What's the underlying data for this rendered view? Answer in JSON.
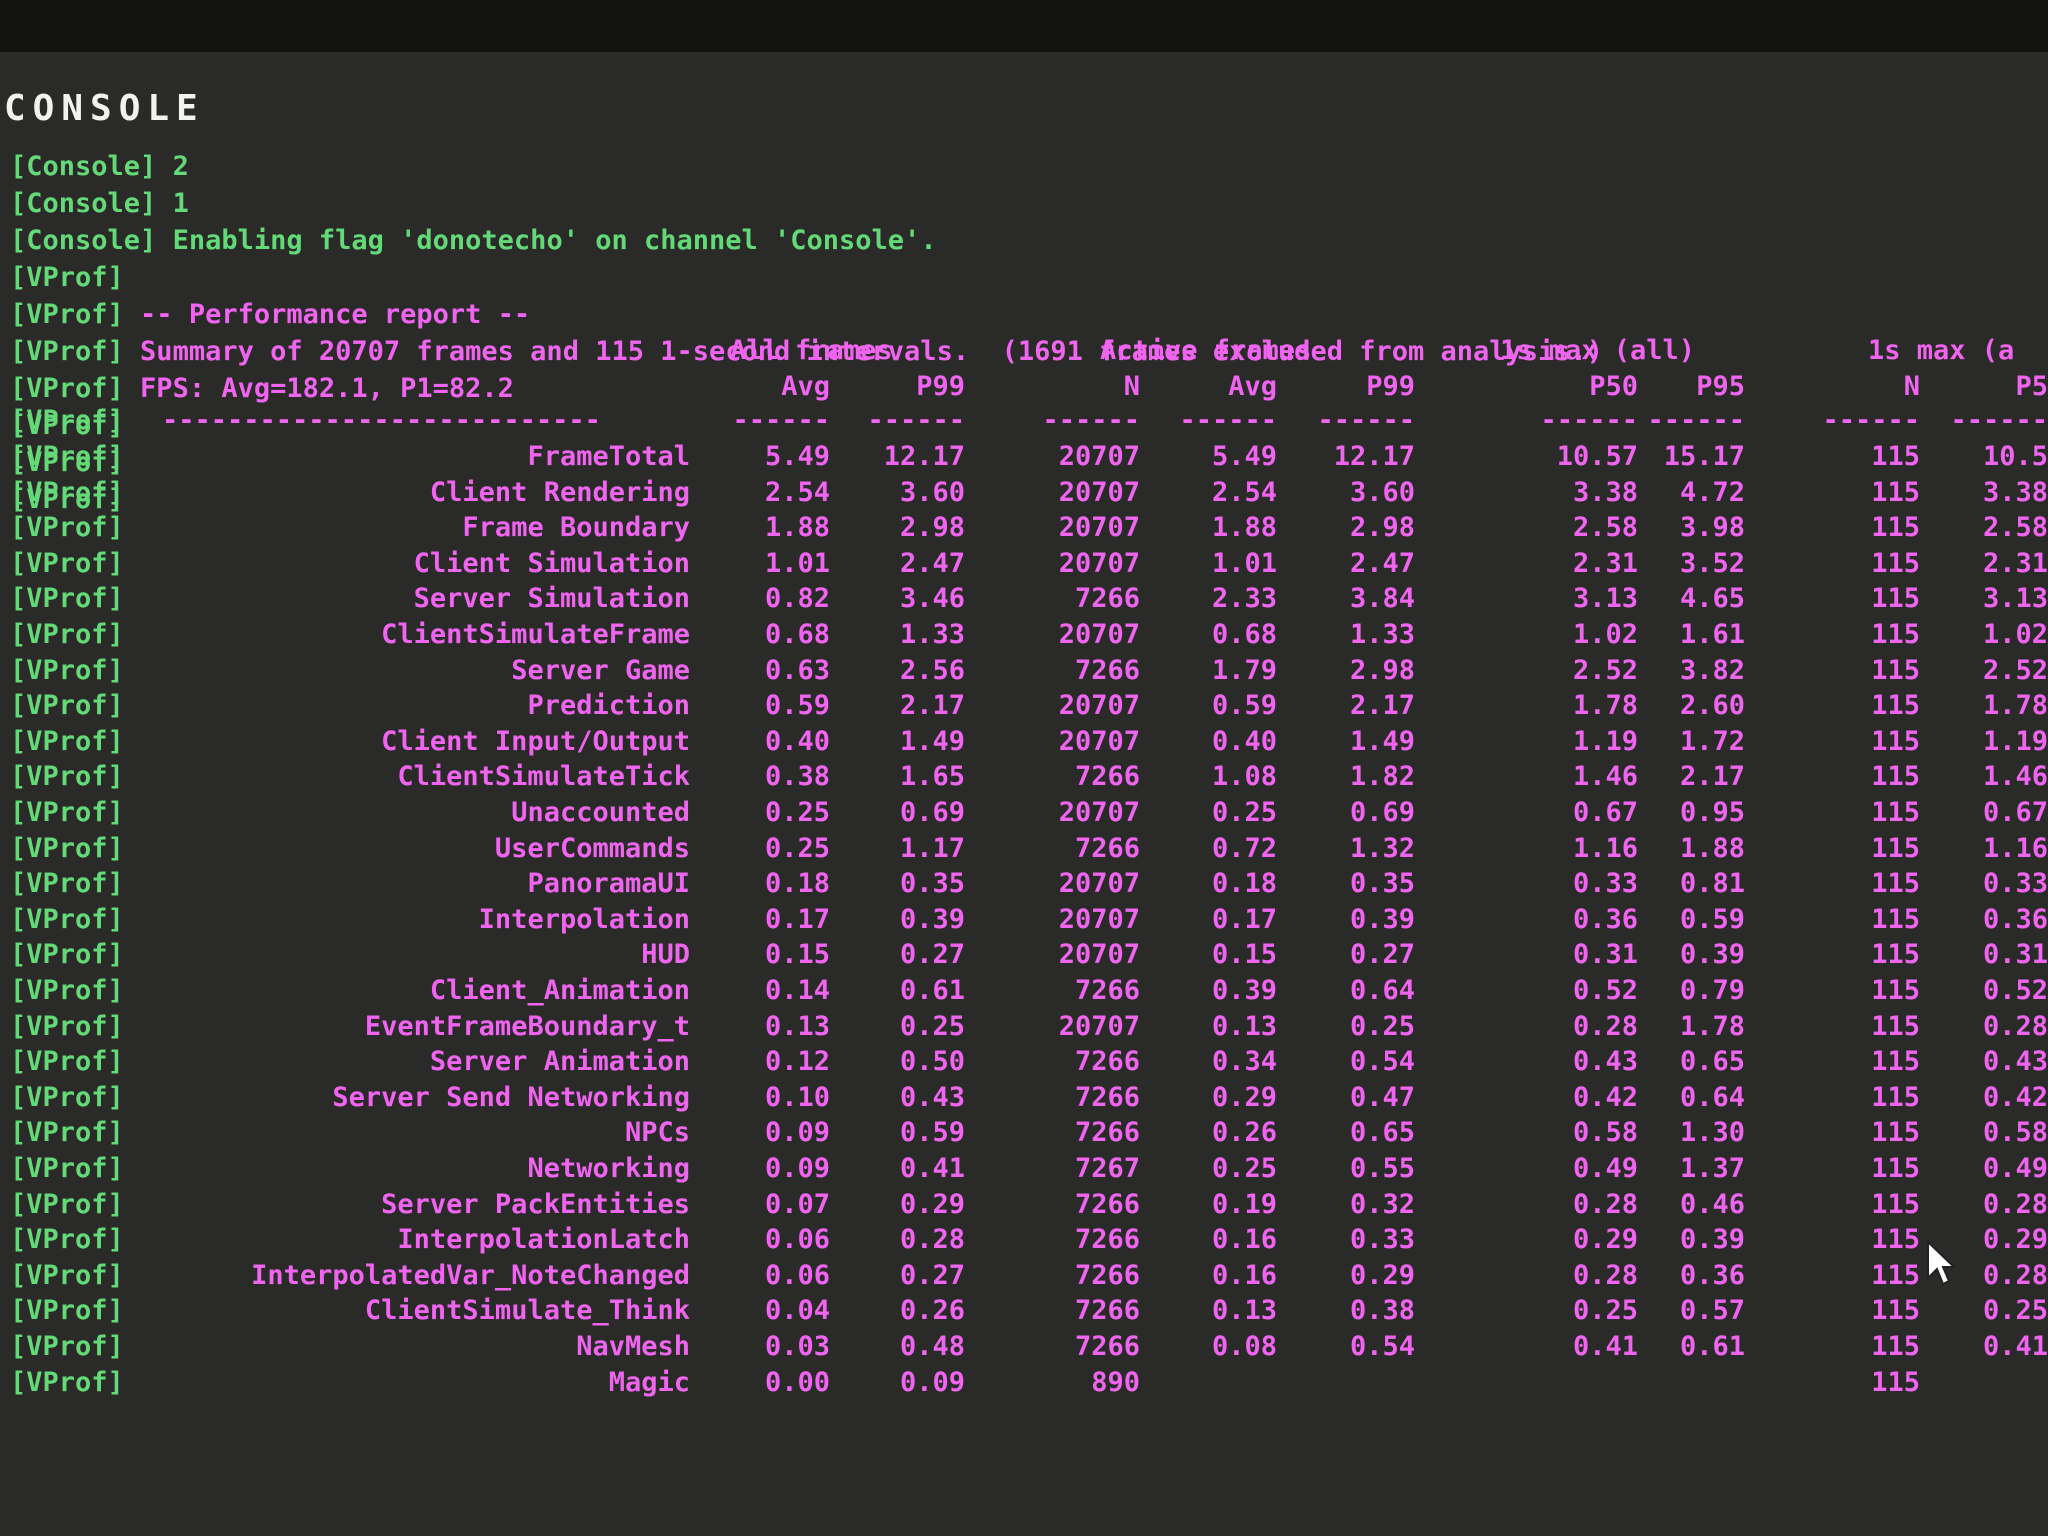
{
  "console": {
    "title": "CONSOLE",
    "lines": [
      {
        "tag": "[Console]",
        "text": " 2",
        "color": "green"
      },
      {
        "tag": "[Console]",
        "text": " 1",
        "color": "green"
      },
      {
        "tag": "[Console]",
        "text": " Enabling flag 'donotecho' on channel 'Console'.",
        "color": "green"
      },
      {
        "tag": "[VProf]",
        "text": "",
        "color": "pink"
      },
      {
        "tag": "[VProf]",
        "text": " -- Performance report --",
        "color": "pink"
      },
      {
        "tag": "[VProf]",
        "text": " Summary of 20707 frames and 115 1-second intervals.  (1691 frames excluded from analysis.)",
        "color": "pink"
      },
      {
        "tag": "[VProf]",
        "text": " FPS: Avg=182.1, P1=82.2",
        "color": "pink"
      },
      {
        "tag": "[VProf]",
        "text": "",
        "color": "pink"
      },
      {
        "tag": "[VProf]",
        "text": "",
        "color": "pink"
      },
      {
        "tag": "[VProf]",
        "text": "",
        "color": "pink"
      }
    ]
  },
  "table": {
    "group_headers": [
      "All frames",
      "Active frames",
      "1s max (all)",
      "1s max (a"
    ],
    "column_headers": [
      "Avg",
      "P99",
      "N",
      "Avg",
      "P99",
      "P50",
      "P95",
      "N",
      "P5"
    ],
    "separator_label": "---------------------------",
    "column_separator": "------",
    "row_tag": "[VProf]",
    "rows": [
      {
        "name": "FrameTotal",
        "values": [
          "5.49",
          "12.17",
          "20707",
          "5.49",
          "12.17",
          "10.57",
          "15.17",
          "115",
          "10.5"
        ]
      },
      {
        "name": "Client Rendering",
        "values": [
          "2.54",
          "3.60",
          "20707",
          "2.54",
          "3.60",
          "3.38",
          "4.72",
          "115",
          "3.38"
        ]
      },
      {
        "name": "Frame Boundary",
        "values": [
          "1.88",
          "2.98",
          "20707",
          "1.88",
          "2.98",
          "2.58",
          "3.98",
          "115",
          "2.58"
        ]
      },
      {
        "name": "Client Simulation",
        "values": [
          "1.01",
          "2.47",
          "20707",
          "1.01",
          "2.47",
          "2.31",
          "3.52",
          "115",
          "2.31"
        ]
      },
      {
        "name": "Server Simulation",
        "values": [
          "0.82",
          "3.46",
          "7266",
          "2.33",
          "3.84",
          "3.13",
          "4.65",
          "115",
          "3.13"
        ]
      },
      {
        "name": "ClientSimulateFrame",
        "values": [
          "0.68",
          "1.33",
          "20707",
          "0.68",
          "1.33",
          "1.02",
          "1.61",
          "115",
          "1.02"
        ]
      },
      {
        "name": "Server Game",
        "values": [
          "0.63",
          "2.56",
          "7266",
          "1.79",
          "2.98",
          "2.52",
          "3.82",
          "115",
          "2.52"
        ]
      },
      {
        "name": "Prediction",
        "values": [
          "0.59",
          "2.17",
          "20707",
          "0.59",
          "2.17",
          "1.78",
          "2.60",
          "115",
          "1.78"
        ]
      },
      {
        "name": "Client Input/Output",
        "values": [
          "0.40",
          "1.49",
          "20707",
          "0.40",
          "1.49",
          "1.19",
          "1.72",
          "115",
          "1.19"
        ]
      },
      {
        "name": "ClientSimulateTick",
        "values": [
          "0.38",
          "1.65",
          "7266",
          "1.08",
          "1.82",
          "1.46",
          "2.17",
          "115",
          "1.46"
        ]
      },
      {
        "name": "Unaccounted",
        "values": [
          "0.25",
          "0.69",
          "20707",
          "0.25",
          "0.69",
          "0.67",
          "0.95",
          "115",
          "0.67"
        ]
      },
      {
        "name": "UserCommands",
        "values": [
          "0.25",
          "1.17",
          "7266",
          "0.72",
          "1.32",
          "1.16",
          "1.88",
          "115",
          "1.16"
        ]
      },
      {
        "name": "PanoramaUI",
        "values": [
          "0.18",
          "0.35",
          "20707",
          "0.18",
          "0.35",
          "0.33",
          "0.81",
          "115",
          "0.33"
        ]
      },
      {
        "name": "Interpolation",
        "values": [
          "0.17",
          "0.39",
          "20707",
          "0.17",
          "0.39",
          "0.36",
          "0.59",
          "115",
          "0.36"
        ]
      },
      {
        "name": "HUD",
        "values": [
          "0.15",
          "0.27",
          "20707",
          "0.15",
          "0.27",
          "0.31",
          "0.39",
          "115",
          "0.31"
        ]
      },
      {
        "name": "Client_Animation",
        "values": [
          "0.14",
          "0.61",
          "7266",
          "0.39",
          "0.64",
          "0.52",
          "0.79",
          "115",
          "0.52"
        ]
      },
      {
        "name": "EventFrameBoundary_t",
        "values": [
          "0.13",
          "0.25",
          "20707",
          "0.13",
          "0.25",
          "0.28",
          "1.78",
          "115",
          "0.28"
        ]
      },
      {
        "name": "Server Animation",
        "values": [
          "0.12",
          "0.50",
          "7266",
          "0.34",
          "0.54",
          "0.43",
          "0.65",
          "115",
          "0.43"
        ]
      },
      {
        "name": "Server Send Networking",
        "values": [
          "0.10",
          "0.43",
          "7266",
          "0.29",
          "0.47",
          "0.42",
          "0.64",
          "115",
          "0.42"
        ]
      },
      {
        "name": "NPCs",
        "values": [
          "0.09",
          "0.59",
          "7266",
          "0.26",
          "0.65",
          "0.58",
          "1.30",
          "115",
          "0.58"
        ]
      },
      {
        "name": "Networking",
        "values": [
          "0.09",
          "0.41",
          "7267",
          "0.25",
          "0.55",
          "0.49",
          "1.37",
          "115",
          "0.49"
        ]
      },
      {
        "name": "Server PackEntities",
        "values": [
          "0.07",
          "0.29",
          "7266",
          "0.19",
          "0.32",
          "0.28",
          "0.46",
          "115",
          "0.28"
        ]
      },
      {
        "name": "InterpolationLatch",
        "values": [
          "0.06",
          "0.28",
          "7266",
          "0.16",
          "0.33",
          "0.29",
          "0.39",
          "115",
          "0.29"
        ]
      },
      {
        "name": "InterpolatedVar_NoteChanged",
        "values": [
          "0.06",
          "0.27",
          "7266",
          "0.16",
          "0.29",
          "0.28",
          "0.36",
          "115",
          "0.28"
        ]
      },
      {
        "name": "ClientSimulate_Think",
        "values": [
          "0.04",
          "0.26",
          "7266",
          "0.13",
          "0.38",
          "0.25",
          "0.57",
          "115",
          "0.25"
        ]
      },
      {
        "name": "NavMesh",
        "values": [
          "0.03",
          "0.48",
          "7266",
          "0.08",
          "0.54",
          "0.41",
          "0.61",
          "115",
          "0.41"
        ]
      },
      {
        "name": "Magic",
        "values": [
          "0.00",
          "0.09",
          "890",
          "",
          "",
          "",
          "",
          "115",
          ""
        ]
      }
    ]
  }
}
